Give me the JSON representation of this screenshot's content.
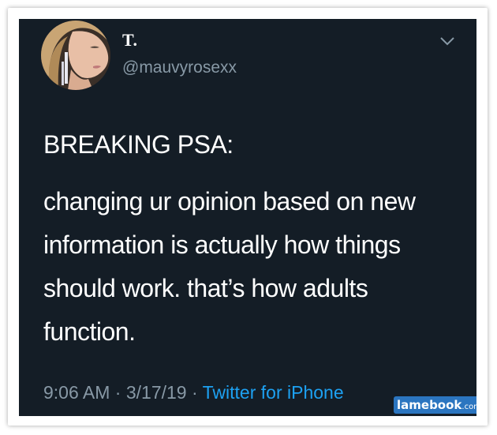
{
  "tweet": {
    "display_name": "T.",
    "handle": "@mauvyrosexx",
    "headline": "BREAKING PSA:",
    "body": "changing ur opinion based on new information is actually how things should work. that’s how adults function.",
    "time": "9:06 AM",
    "date": "3/17/19",
    "separator": "·",
    "source": "Twitter for iPhone"
  },
  "icons": {
    "menu": "chevron-down-icon"
  },
  "watermark": {
    "main": "lamebook",
    "tld": ".com"
  },
  "colors": {
    "background": "#141d26",
    "text_primary": "#ffffff",
    "text_secondary": "#8899a6",
    "link": "#1da1f2",
    "watermark_bg": "#2b75c0"
  }
}
